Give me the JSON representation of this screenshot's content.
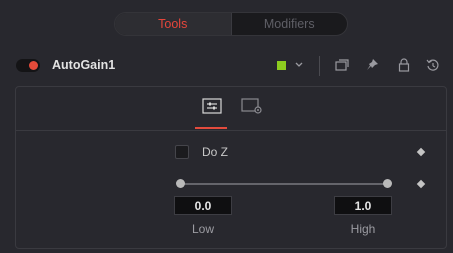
{
  "tabs": {
    "tools_label": "Tools",
    "modifiers_label": "Modifiers"
  },
  "tool": {
    "name": "AutoGain1",
    "enabled": true,
    "color_swatch": "#8dcc1f"
  },
  "header_icons": [
    "toggle-icon",
    "chevron-down-icon",
    "versions-icon",
    "pin-icon",
    "lock-icon",
    "reset-icon"
  ],
  "panel": {
    "tab_icons": [
      "controls-icon",
      "settings-icon"
    ],
    "active_tab": "controls-icon",
    "do_z": {
      "label": "Do Z",
      "checked": false
    },
    "range": {
      "low_value": "0.0",
      "high_value": "1.0",
      "low_label": "Low",
      "high_label": "High"
    }
  },
  "colors": {
    "accent": "#e5463b",
    "background": "#28282e"
  }
}
